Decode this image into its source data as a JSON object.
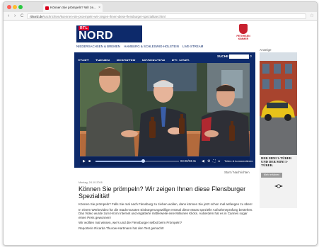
{
  "browser": {
    "tab_title": "Können Sie prömpeln? Wir ze...",
    "tab_close": "×",
    "back": "‹",
    "forward": "›",
    "reload": "C",
    "url_host": "rtlnord.de",
    "url_path": "/nachrichten/koennen-sie-proempeln-wir-zeigen-ihnen-diese-flensburger-spezialitaet.html",
    "bookmark_icon": "star-icon"
  },
  "header": {
    "logo_top": "RTL",
    "logo_main": "NORD",
    "partner_name": "PETERSEN KIMMER",
    "regions": [
      "NIEDERSACHSEN & BREMEN",
      "HAMBURG & SCHLESWIG-HOLSTEIN",
      "LIVE-STREAM"
    ],
    "ad_label": "Anzeige"
  },
  "nav": {
    "items": [
      "START",
      "THEMEN",
      "REPORTER",
      "MODERATION",
      "RTL NORD"
    ],
    "search_label": "SUCHE",
    "search_placeholder": ""
  },
  "player": {
    "progress": 0.57,
    "time": "03:20/03:41",
    "comment": "Teilen & kommentieren",
    "play_icon": "play-icon",
    "stop_icon": "stop-icon",
    "volume_icon": "volume-icon",
    "fullscreen_icon": "fullscreen-icon"
  },
  "breadcrumb": "Start / Nachrichten",
  "article": {
    "date": "Montag, 24.10.2016",
    "title": "Können Sie prömpeln? Wir zeigen Ihnen diese Flensburger Spezialität!",
    "paragraphs": [
      "Können Sie prömpeln? Falls Sie mal nach Flensburg zu ziehen wollen, dann können Sie jetzt schon mal anfangen zu üben!",
      "In einem Werbevideo für die Stadt mussten Einbürgerungswillige erstmal diese etwas spezielle Aufnahmeprüfung bestehen. Das Video wurde zum Hit im Internet und ergatterte mittlerweile eine Millionen Klicks. Außerdem hat es in Cannes sogar einen Preis gewonnen!",
      "Wir wollten mal wissen, wie's und die Flensburger selbst beim Prömpeln?"
    ],
    "credit": "Reporterin Ricarda Thurow-Hartmann hat den Test gemacht!"
  },
  "ad": {
    "headline": "DER MINI 3-TÜRER UND DER MINI 5-TÜRER.",
    "button": "Mehr erfahren",
    "brand_icon": "mini-logo-icon"
  },
  "colors": {
    "brand_navy": "#0d2a6b",
    "brand_red": "#e4002b"
  }
}
